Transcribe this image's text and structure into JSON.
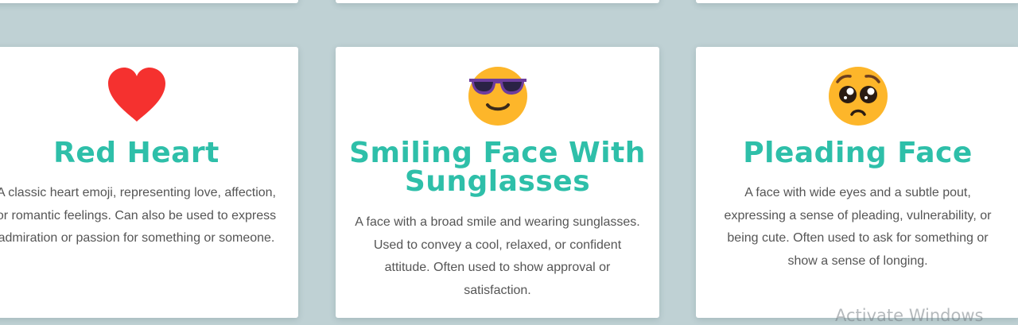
{
  "cards": [
    {
      "emoji_icon": "red-heart-icon",
      "title": "Red Heart",
      "description": "A classic heart emoji, representing love, affection, or romantic feelings. Can also be used to express admiration or passion for something or someone."
    },
    {
      "emoji_icon": "smiling-face-with-sunglasses-icon",
      "title": "Smiling Face With Sunglasses",
      "description": "A face with a broad smile and wearing sunglasses. Used to convey a cool, relaxed, or confident attitude. Often used to show approval or satisfaction."
    },
    {
      "emoji_icon": "pleading-face-icon",
      "title": "Pleading Face",
      "description": "A face with wide eyes and a subtle pout, expressing a sense of pleading, vulnerability, or being cute. Often used to ask for something or show a sense of longing."
    }
  ],
  "watermark": "Activate Windows",
  "colors": {
    "background": "#bfd1d4",
    "title": "#2ebfa9",
    "text": "#555555",
    "card": "#ffffff"
  }
}
